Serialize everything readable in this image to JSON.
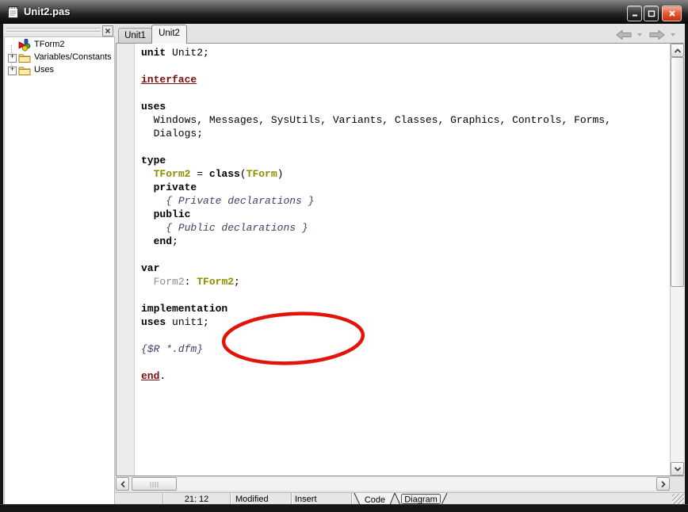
{
  "window": {
    "title": "Unit2.pas",
    "controls": {
      "minimize": "minimize",
      "maximize": "maximize",
      "close": "close"
    }
  },
  "left_panel": {
    "close": "close",
    "tree": [
      {
        "label": "TForm2",
        "icon": "form-class-icon",
        "expandable": false
      },
      {
        "label": "Variables/Constants",
        "icon": "folder-icon",
        "expandable": true,
        "expander": "+"
      },
      {
        "label": "Uses",
        "icon": "folder-icon",
        "expandable": true,
        "expander": "+"
      }
    ]
  },
  "tabs": [
    {
      "label": "Unit1",
      "active": false
    },
    {
      "label": "Unit2",
      "active": true
    }
  ],
  "editor": {
    "lines": [
      [
        [
          "kw",
          "unit"
        ],
        [
          "pl",
          " Unit2;"
        ]
      ],
      [],
      [
        [
          "lk",
          "interface"
        ]
      ],
      [],
      [
        [
          "kw",
          "uses"
        ]
      ],
      [
        [
          "pl",
          "  Windows, Messages, SysUtils, Variants, Classes, Graphics, Controls, Forms,"
        ]
      ],
      [
        [
          "pl",
          "  Dialogs;"
        ]
      ],
      [],
      [
        [
          "kw",
          "type"
        ]
      ],
      [
        [
          "pl",
          "  "
        ],
        [
          "ty",
          "TForm2"
        ],
        [
          "pl",
          " = "
        ],
        [
          "kw",
          "class"
        ],
        [
          "pl",
          "("
        ],
        [
          "ty",
          "TForm"
        ],
        [
          "pl",
          ")"
        ]
      ],
      [
        [
          "pl",
          "  "
        ],
        [
          "kw",
          "private"
        ]
      ],
      [
        [
          "pl",
          "    "
        ],
        [
          "cm",
          "{ Private declarations }"
        ]
      ],
      [
        [
          "pl",
          "  "
        ],
        [
          "kw",
          "public"
        ]
      ],
      [
        [
          "pl",
          "    "
        ],
        [
          "cm",
          "{ Public declarations }"
        ]
      ],
      [
        [
          "pl",
          "  "
        ],
        [
          "kw",
          "end"
        ],
        [
          "pl",
          ";"
        ]
      ],
      [],
      [
        [
          "kw",
          "var"
        ]
      ],
      [
        [
          "pl",
          "  "
        ],
        [
          "id",
          "Form2"
        ],
        [
          "pl",
          ": "
        ],
        [
          "ty",
          "TForm2"
        ],
        [
          "pl",
          ";"
        ]
      ],
      [],
      [
        [
          "kw",
          "implementation"
        ]
      ],
      [
        [
          "kw",
          "uses"
        ],
        [
          "pl",
          " unit1;"
        ]
      ],
      [],
      [
        [
          "cm",
          "{$R *.dfm}"
        ]
      ],
      [],
      [
        [
          "lk",
          "end"
        ],
        [
          "pl",
          "."
        ]
      ]
    ]
  },
  "annotation": {
    "shape": "ellipse",
    "color": "#e01408",
    "circled_text": "implementation uses unit1;"
  },
  "statusbar": {
    "position": "21: 12",
    "modified": "Modified",
    "insert_mode": "Insert",
    "doc_tabs": [
      {
        "label": "Code",
        "active": true
      },
      {
        "label": "Diagram",
        "active": false
      }
    ]
  },
  "colors": {
    "keyword": "#000000",
    "type_identifier": "#8f8f00",
    "comment": "#3f3f68",
    "section_link": "#7d0d0d",
    "dim_identifier": "#8c8c8c",
    "annotation_red": "#e01408",
    "titlebar_dark": "#232323",
    "close_button": "#c22f0e"
  }
}
